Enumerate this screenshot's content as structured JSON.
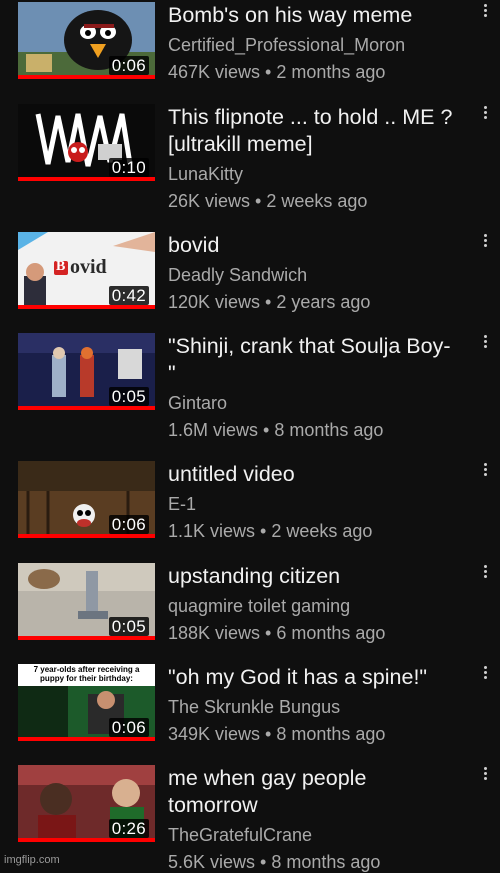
{
  "videos": [
    {
      "title": "Bomb's on his way meme",
      "channel": "Certified_Professional_Moron",
      "stats": "467K views • 2 months ago",
      "duration": "0:06",
      "watched_fraction": 1.0
    },
    {
      "title": "This flipnote ... to hold .. ME ? [ultrakill meme]",
      "channel": "LunaKitty",
      "stats": "26K views • 2 weeks ago",
      "duration": "0:10",
      "watched_fraction": 1.0
    },
    {
      "title": "bovid",
      "channel": "Deadly Sandwich",
      "stats": "120K views • 2 years ago",
      "duration": "0:42",
      "watched_fraction": 1.0,
      "thumb_text": "ovid",
      "thumb_badge": "B"
    },
    {
      "title": "\"Shinji, crank that Soulja Boy-\"",
      "channel": "Gintaro",
      "stats": "1.6M views • 8 months ago",
      "duration": "0:05",
      "watched_fraction": 1.0
    },
    {
      "title": "untitled video",
      "channel": "E-1",
      "stats": "1.1K views • 2 weeks ago",
      "duration": "0:06",
      "watched_fraction": 1.0
    },
    {
      "title": "upstanding citizen",
      "channel": "quagmire toilet gaming",
      "stats": "188K views • 6 months ago",
      "duration": "0:05",
      "watched_fraction": 1.0
    },
    {
      "title": "\"oh my God it has a spine!\"",
      "channel": "The Skrunkle Bungus",
      "stats": "349K views • 8 months ago",
      "duration": "0:06",
      "watched_fraction": 1.0,
      "thumb_caption": "7 year-olds after receiving a puppy for their birthday:"
    },
    {
      "title": "me when gay people tomorrow",
      "channel": "TheGratefulCrane",
      "stats": "5.6K views • 8 months ago",
      "duration": "0:26",
      "watched_fraction": 1.0
    }
  ],
  "watermark": "imgflip.com",
  "colors": {
    "background": "#0f0f0f",
    "title": "#f1f1f1",
    "secondary": "#aaaaaa",
    "progress": "#ff0000"
  },
  "icons": {
    "menu": "more-vert-icon"
  }
}
